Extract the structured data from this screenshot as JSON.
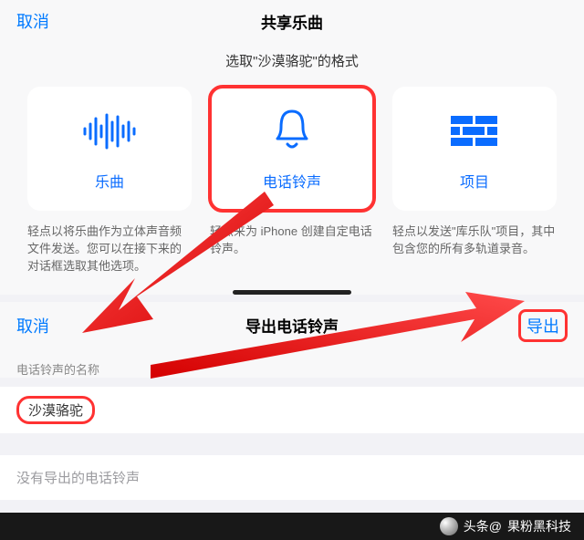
{
  "screen1": {
    "cancel": "取消",
    "title": "共享乐曲",
    "subtitle": "选取\"沙漠骆驼\"的格式",
    "cards": {
      "song": {
        "label": "乐曲",
        "desc": "轻点以将乐曲作为立体声音频文件发送。您可以在接下来的对话框选取其他选项。"
      },
      "ringtone": {
        "label": "电话铃声",
        "desc": "轻点来为 iPhone 创建自定电话铃声。"
      },
      "project": {
        "label": "项目",
        "desc": "轻点以发送\"库乐队\"项目，其中包含您的所有多轨道录音。"
      }
    }
  },
  "screen2": {
    "cancel": "取消",
    "title": "导出电话铃声",
    "export": "导出",
    "fieldLabel": "电话铃声的名称",
    "fieldValue": "沙漠骆驼",
    "emptyMsg": "没有导出的电话铃声"
  },
  "footer": {
    "prefix": "头条@",
    "author": "果粉黑科技"
  }
}
